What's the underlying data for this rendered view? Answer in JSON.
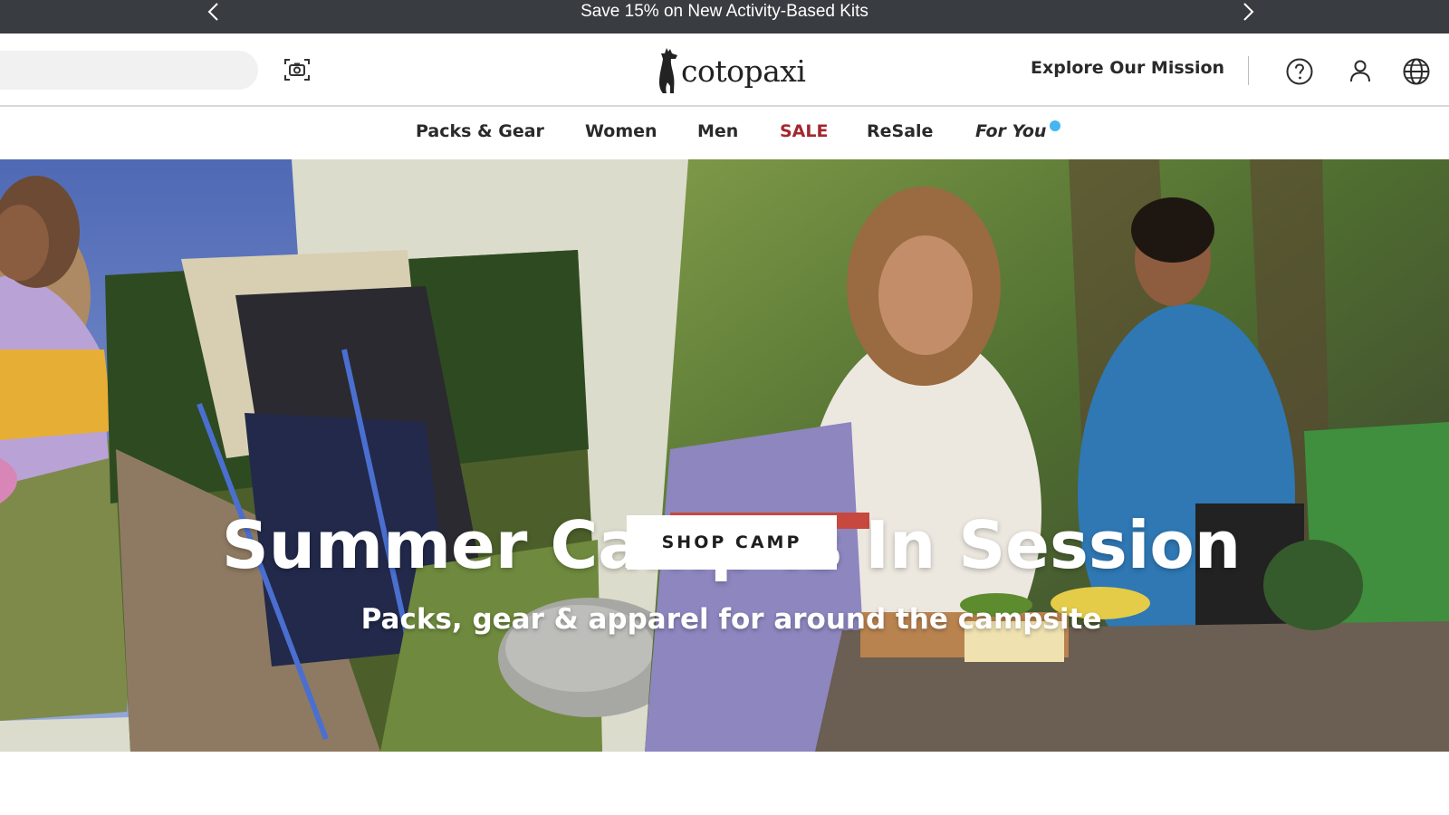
{
  "promo": {
    "text": "Save 15% on New Activity-Based Kits",
    "prev_icon": "chevron-left-icon",
    "next_icon": "chevron-right-icon"
  },
  "header": {
    "search": {
      "value": "",
      "placeholder": ""
    },
    "camera_icon": "camera-search-icon",
    "logo_text": "cotopaxi",
    "mission_link": "Explore Our Mission",
    "icons": [
      "help-icon",
      "account-icon",
      "globe-icon"
    ]
  },
  "nav": {
    "items": [
      {
        "label": "Packs & Gear"
      },
      {
        "label": "Women"
      },
      {
        "label": "Men"
      },
      {
        "label": "SALE"
      },
      {
        "label": "ReSale"
      },
      {
        "label": "For You"
      }
    ],
    "sale_color": "#a3272f",
    "notification_dot_color": "#46b6f0"
  },
  "hero": {
    "title": "Summer Camp Is In Session",
    "subtitle": "Packs, gear & apparel for around the campsite",
    "cta": "SHOP CAMP"
  },
  "colors": {
    "promo_bg": "#393d41",
    "hero_bg": "#dcdccc"
  }
}
